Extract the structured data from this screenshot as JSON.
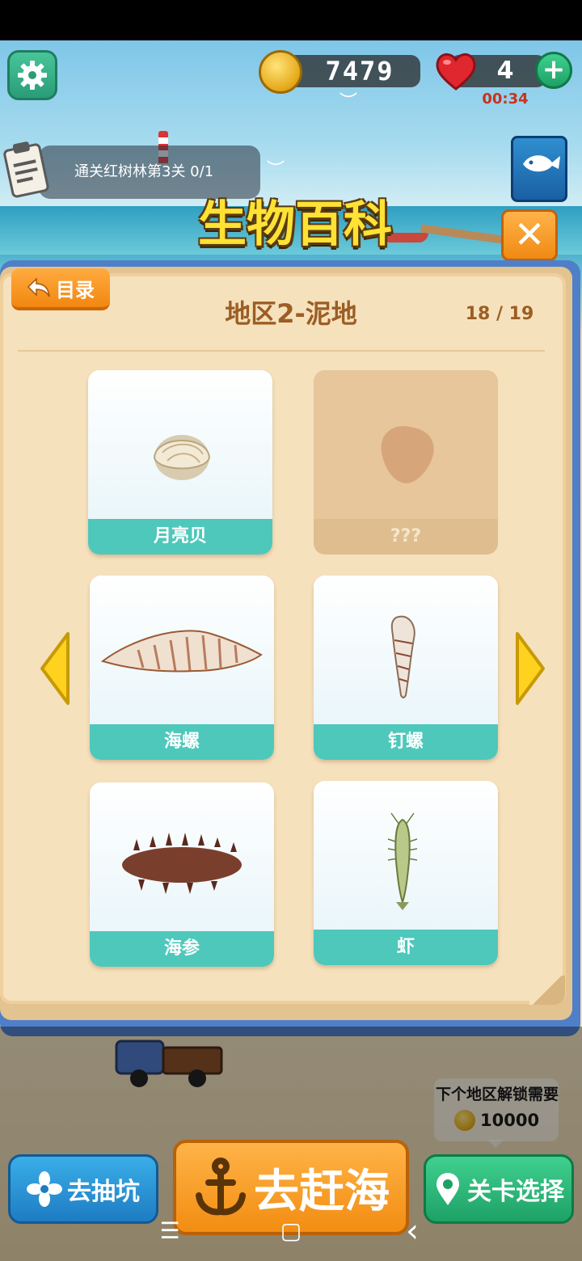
{
  "hud": {
    "coins": "7479",
    "lives": "4",
    "lives_timer": "00:34",
    "add_lives_label": "+"
  },
  "quest": {
    "text": "通关红树林第3关 0/1"
  },
  "page": {
    "title": "生物百科",
    "close_label": "✕"
  },
  "panel": {
    "back_label": "目录",
    "region_title": "地区2-泥地",
    "progress": "18 / 19"
  },
  "cards": [
    {
      "name": "月亮贝",
      "image": "moon-shell",
      "locked": false
    },
    {
      "name": "???",
      "image": "locked-silhouette",
      "locked": true
    },
    {
      "name": "海螺",
      "image": "conch",
      "locked": false
    },
    {
      "name": "钉螺",
      "image": "auger-snail",
      "locked": false
    },
    {
      "name": "海参",
      "image": "sea-cucumber",
      "locked": false
    },
    {
      "name": "虾",
      "image": "shrimp",
      "locked": false
    }
  ],
  "unlock": {
    "text": "下个地区解锁需要",
    "cost": "10000"
  },
  "bottom_buttons": {
    "dig": "去抽坑",
    "sea": "去赶海",
    "level_select": "关卡选择"
  },
  "nav": {
    "menu": "☰",
    "home": "▢",
    "back": "‹"
  },
  "colors": {
    "card_label": "#4ec8bb",
    "panel": "#f6e1bd",
    "title": "#ffe234",
    "region_title": "#9b5e24"
  }
}
